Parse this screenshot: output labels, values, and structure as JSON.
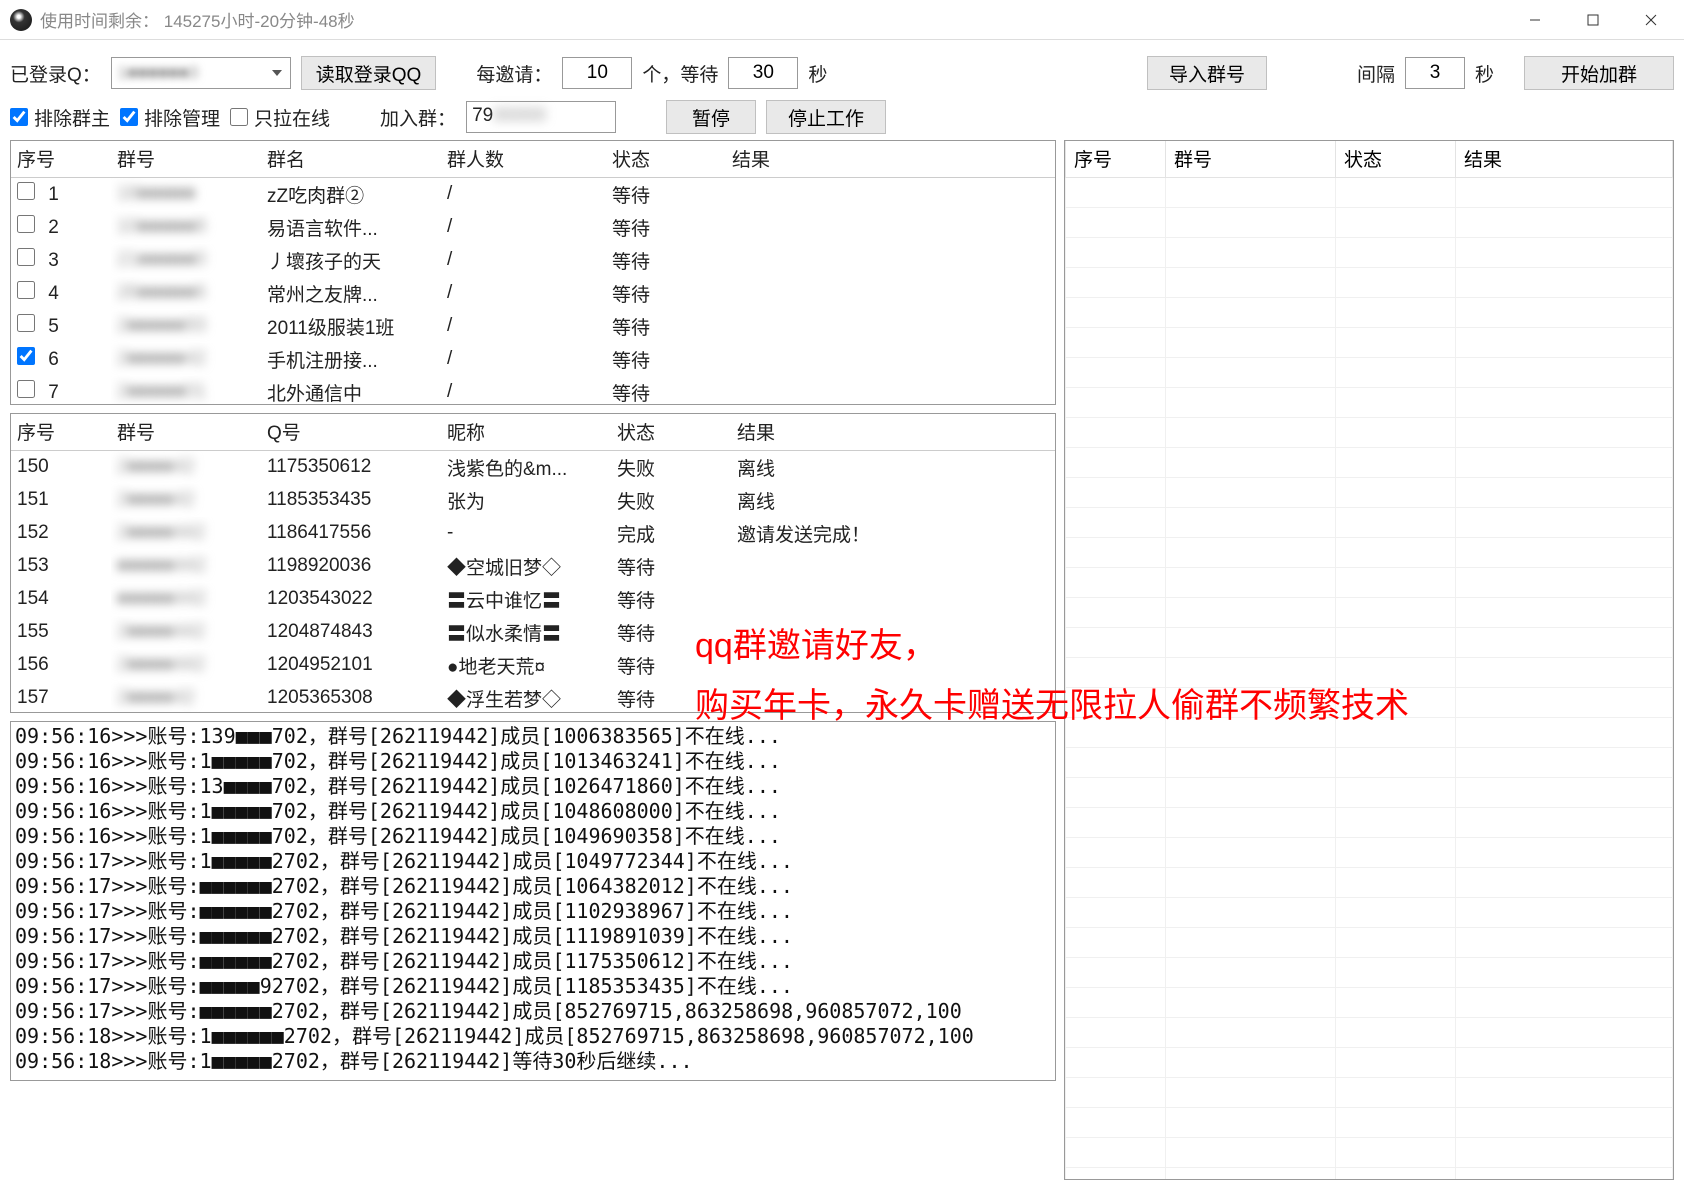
{
  "titlebar": {
    "prefix": "使用时间剩余：",
    "time": "145275小时-20分钟-48秒"
  },
  "row1": {
    "logged_label": "已登录Q：",
    "account_masked": "1■■■■■■3",
    "read_login": "读取登录QQ",
    "per_invite_label": "每邀请：",
    "per_invite_value": "10",
    "unit_wait": "个，等待",
    "wait_value": "30",
    "seconds": "秒",
    "import_group": "导入群号",
    "interval_label": "间隔",
    "interval_value": "3",
    "interval_sec": "秒",
    "start_join": "开始加群"
  },
  "row2": {
    "exclude_owner": "排除群主",
    "exclude_admin": "排除管理",
    "only_online": "只拉在线",
    "join_group_label": "加入群：",
    "join_group_value": "79",
    "pause": "暂停",
    "stop": "停止工作"
  },
  "table1": {
    "headers": [
      "序号",
      "群号",
      "群名",
      "群人数",
      "状态",
      "结果"
    ],
    "rows": [
      {
        "chk": false,
        "no": "1",
        "gid": "18■■■■■",
        "name": "zZ吃肉群②",
        "cnt": "/",
        "st": "等待",
        "res": ""
      },
      {
        "chk": false,
        "no": "2",
        "gid": "10■■■■■8",
        "name": "易语言软件...",
        "cnt": "/",
        "st": "等待",
        "res": ""
      },
      {
        "chk": false,
        "no": "3",
        "gid": "21■■■■■0",
        "name": "丿壞孩子的天",
        "cnt": "/",
        "st": "等待",
        "res": ""
      },
      {
        "chk": false,
        "no": "4",
        "gid": "26■■■■■6",
        "name": "常州之友牌...",
        "cnt": "/",
        "st": "等待",
        "res": ""
      },
      {
        "chk": false,
        "no": "5",
        "gid": "2■■■■■93",
        "name": "2011级服装1班",
        "cnt": "/",
        "st": "等待",
        "res": ""
      },
      {
        "chk": true,
        "no": "6",
        "gid": "2■■■■■42",
        "name": "手机注册接...",
        "cnt": "/",
        "st": "等待",
        "res": ""
      },
      {
        "chk": false,
        "no": "7",
        "gid": "2■■■■■01",
        "name": "北外通信中",
        "cnt": "/",
        "st": "等待",
        "res": ""
      }
    ]
  },
  "table2": {
    "headers": [
      "序号",
      "群号",
      "Q号",
      "昵称",
      "状态",
      "结果"
    ],
    "rows": [
      {
        "no": "150",
        "gid": "2■■■■42",
        "qq": "1175350612",
        "nick": "浅紫色的&m...",
        "st": "失败",
        "res": "离线"
      },
      {
        "no": "151",
        "gid": "2■■■■42",
        "qq": "1185353435",
        "nick": "张为",
        "st": "失败",
        "res": "离线"
      },
      {
        "no": "152",
        "gid": "2■■■■442",
        "qq": "1186417556",
        "nick": "-",
        "st": "完成",
        "res": "邀请发送完成！"
      },
      {
        "no": "153",
        "gid": "■■■■■442",
        "qq": "1198920036",
        "nick": "◆空城旧梦◇",
        "st": "等待",
        "res": ""
      },
      {
        "no": "154",
        "gid": "■■■■■442",
        "qq": "1203543022",
        "nick": "〓云中谁忆〓",
        "st": "等待",
        "res": ""
      },
      {
        "no": "155",
        "gid": "2■■■■442",
        "qq": "1204874843",
        "nick": "〓似水柔情〓",
        "st": "等待",
        "res": ""
      },
      {
        "no": "156",
        "gid": "2■■■■442",
        "qq": "1204952101",
        "nick": "●地老天荒¤",
        "st": "等待",
        "res": ""
      },
      {
        "no": "157",
        "gid": "2■■■■42",
        "qq": "1205365308",
        "nick": "◆浮生若梦◇",
        "st": "等待",
        "res": ""
      }
    ]
  },
  "table3": {
    "headers": [
      "序号",
      "群号",
      "状态",
      "结果"
    ]
  },
  "log_lines": [
    "09:56:16>>>账号:139■■■702，群号[262119442]成员[1006383565]不在线...",
    "09:56:16>>>账号:1■■■■■702，群号[262119442]成员[1013463241]不在线...",
    "09:56:16>>>账号:13■■■■702，群号[262119442]成员[1026471860]不在线...",
    "09:56:16>>>账号:1■■■■■702，群号[262119442]成员[1048608000]不在线...",
    "09:56:16>>>账号:1■■■■■702，群号[262119442]成员[1049690358]不在线...",
    "09:56:17>>>账号:1■■■■■2702，群号[262119442]成员[1049772344]不在线...",
    "09:56:17>>>账号:■■■■■■2702，群号[262119442]成员[1064382012]不在线...",
    "09:56:17>>>账号:■■■■■■2702，群号[262119442]成员[1102938967]不在线...",
    "09:56:17>>>账号:■■■■■■2702，群号[262119442]成员[1119891039]不在线...",
    "09:56:17>>>账号:■■■■■■2702，群号[262119442]成员[1175350612]不在线...",
    "09:56:17>>>账号:■■■■■92702，群号[262119442]成员[1185353435]不在线...",
    "09:56:17>>>账号:■■■■■■2702，群号[262119442]成员[852769715,863258698,960857072,100",
    "09:56:18>>>账号:1■■■■■■2702，群号[262119442]成员[852769715,863258698,960857072,100",
    "09:56:18>>>账号:1■■■■■2702，群号[262119442]等待30秒后继续..."
  ],
  "promo": {
    "line1": "qq群邀请好友，",
    "line2": "购买年卡，永久卡赠送无限拉人偷群不频繁技术"
  }
}
